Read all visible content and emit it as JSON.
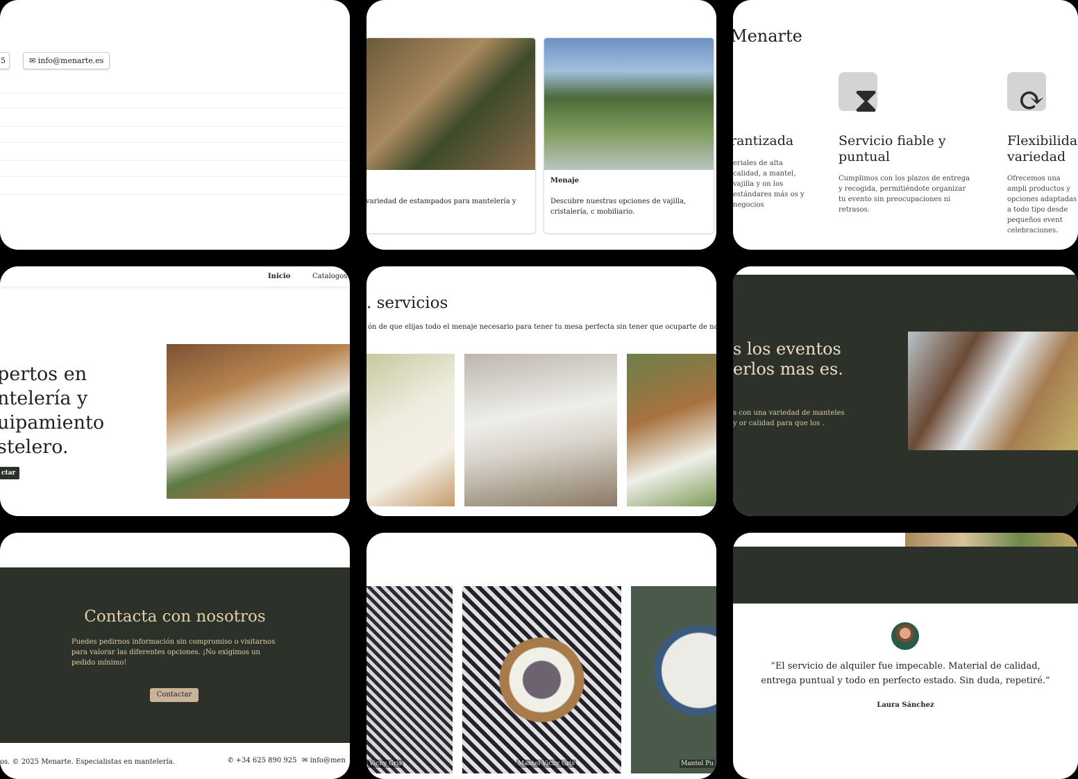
{
  "contact_pills": {
    "phone_partial": "5",
    "email": "info@menarte.es"
  },
  "cards": [
    {
      "title": "",
      "text": "variedad de estampados para mantelería y"
    },
    {
      "title": "Menaje",
      "text": "Descubre nuestras opciones de vajilla, cristalería, c mobiliario."
    }
  ],
  "features": {
    "brand": "Menarte",
    "items": [
      {
        "title": "rantizada",
        "text": "eriales de alta calidad, a mantel, vajilla y on los estándares más os y negocios"
      },
      {
        "title": "Servicio fiable y puntual",
        "text": "Cumplimos con los plazos de entrega y recogida, permitiéndote organizar tu evento sin preocupaciones ni retrasos."
      },
      {
        "title": "Flexibilidad variedad",
        "text": "Ofrecemos una ampli productos y opciones adaptadas a todo tipo desde pequeños event celebraciones."
      }
    ]
  },
  "nav": {
    "items": [
      "Inicio",
      "Catalogos"
    ]
  },
  "hero": {
    "title": "pertos en ntelería y uipamiento stelero.",
    "button": "ctar"
  },
  "services": {
    "title": "servicios",
    "text": "ón de que elijas todo el menaje necesario para tener tu mesa perfecta sin tener que ocuparte de nada."
  },
  "events": {
    "title": "s los eventos erlos mas es.",
    "text": "s con una variedad de manteles y or calidad para que los ."
  },
  "contact": {
    "title": "Contacta con nosotros",
    "text": "Puedes pedirnos información sin compromiso o visitarnos para valorar las diferentes opciones. ¡No exigimos un pedido mínimo!",
    "button": "Contactar"
  },
  "footer": {
    "copyright": "os. © 2025 Menarte. Especialistas en mantelería.",
    "phone": "+34 625 890 925",
    "email": "info@men"
  },
  "gallery": {
    "captions": [
      "Vichy Gris",
      "Mantel Vichy Gris",
      "Mantel Pu"
    ]
  },
  "testimonial": {
    "quote": "“El servicio de alquiler fue impecable. Material de calidad, entrega puntual y todo en perfecto estado. Sin duda, repetiré.”",
    "author": "Laura Sánchez"
  },
  "colors": {
    "dark_green": "#2c3129",
    "beige": "#c9b49a",
    "gold_text": "#e3cfa8"
  }
}
